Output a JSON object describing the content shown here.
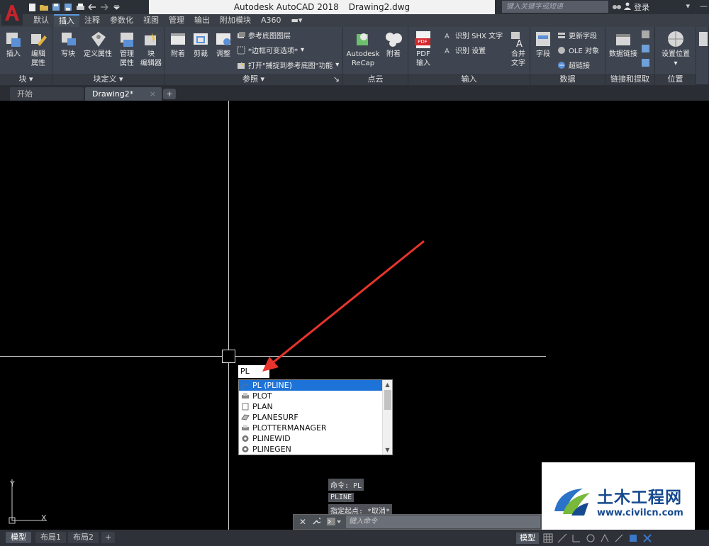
{
  "app": {
    "window_title": "Autodesk AutoCAD 2018",
    "document_name": "Drawing2.dwg",
    "search_placeholder": "键入关键字或短语",
    "login_label": "登录"
  },
  "ribbon_tabs": [
    "默认",
    "插入",
    "注释",
    "参数化",
    "视图",
    "管理",
    "输出",
    "附加模块",
    "A360"
  ],
  "active_tab": "插入",
  "panels": {
    "block": {
      "label": "块",
      "insert": "插入",
      "edit_attr": "编辑\n属性"
    },
    "block_def": {
      "label": "块定义",
      "write_block": "写块",
      "define_attr": "定义属性",
      "manage_attr": "管理\n属性",
      "block_editor": "块\n编辑器"
    },
    "reference": {
      "label": "参照",
      "attach": "附着",
      "clip": "剪裁",
      "adjust": "调整",
      "underlay_layers": "参考底图图层",
      "frame": "*边框可变选项*",
      "snap": "打开\"捕捉到参考底图\"功能"
    },
    "point_cloud": {
      "label": "点云",
      "recap": "Autodesk\nReCap",
      "attach": "附着"
    },
    "import": {
      "label": "输入",
      "pdf": "PDF\n输入",
      "shx": "识别 SHX 文字",
      "settings": "识别 设置",
      "merge_text": "合并\n文字",
      "pdf_badge": "PDF"
    },
    "data": {
      "label": "数据",
      "field": "字段",
      "update_field": "更新字段",
      "ole": "OLE 对象",
      "hyperlink": "超链接"
    },
    "link_extract": {
      "label": "链接和提取",
      "data_link": "数据链接"
    },
    "location": {
      "label": "位置",
      "set_location": "设置位置"
    }
  },
  "doc_tabs": {
    "start": "开始",
    "drawing": "Drawing2*"
  },
  "dynamic_input": "PL",
  "autocomplete": [
    {
      "label": "PL (PLINE)",
      "icon": "pline-icon",
      "selected": true
    },
    {
      "label": "PLOT",
      "icon": "plot-icon",
      "selected": false
    },
    {
      "label": "PLAN",
      "icon": "plan-icon",
      "selected": false
    },
    {
      "label": "PLANESURF",
      "icon": "planesurf-icon",
      "selected": false
    },
    {
      "label": "PLOTTERMANAGER",
      "icon": "plottermanager-icon",
      "selected": false
    },
    {
      "label": "PLINEWID",
      "icon": "gear-icon",
      "selected": false
    },
    {
      "label": "PLINEGEN",
      "icon": "gear-icon",
      "selected": false
    }
  ],
  "command_history": [
    "命令: PL",
    "PLINE",
    "指定起点: *取消*"
  ],
  "command_placeholder": "键入命令",
  "ucs": {
    "x": "X",
    "y": "Y"
  },
  "layout_tabs": [
    "模型",
    "布局1",
    "布局2"
  ],
  "status": {
    "model": "模型"
  },
  "watermark": {
    "cn": "土木工程网",
    "url": "www.civilcn.com"
  },
  "colors": {
    "accent": "#1e73d8",
    "arrow": "#e8342b",
    "logo": "#c8232c",
    "watermark": "#174a8f"
  }
}
